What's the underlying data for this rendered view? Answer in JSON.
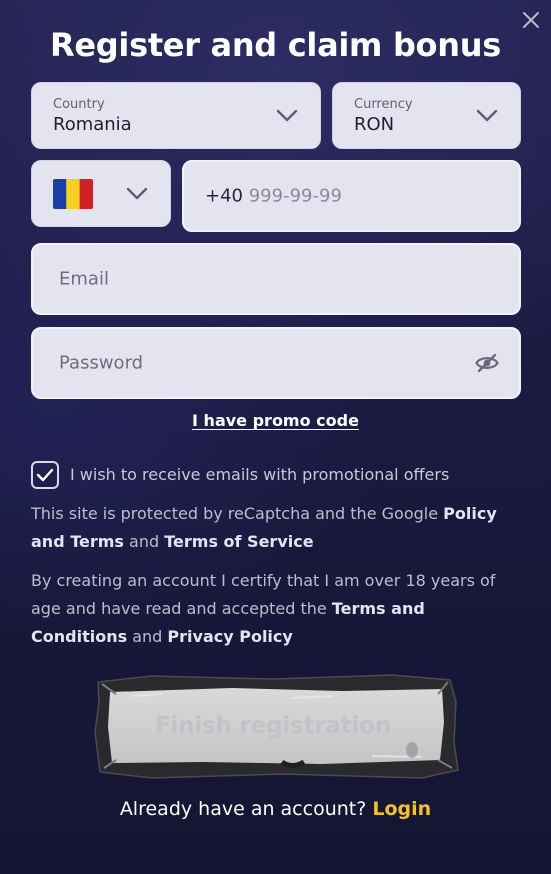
{
  "header": {
    "title": "Register and claim bonus"
  },
  "country": {
    "label": "Country",
    "value": "Romania"
  },
  "currency": {
    "label": "Currency",
    "value": "RON"
  },
  "phone": {
    "flag": "romania-flag-icon",
    "prefix": "+40",
    "mask": "999-99-99"
  },
  "email": {
    "placeholder": "Email"
  },
  "password": {
    "placeholder": "Password",
    "visibility_icon": "eye-slash-icon"
  },
  "promo": {
    "label": "I have promo code"
  },
  "consent": {
    "checked": true,
    "label": "I wish to receive emails with promotional offers"
  },
  "recaptcha": {
    "text_1": "This site is protected by reCaptcha and the Google",
    "policy_link": "Policy and Terms",
    "text_2": "and",
    "terms_link": "Terms of Service"
  },
  "certify": {
    "text_1": "By creating an account I certify that I am over 18 years of age and have read and accepted the",
    "terms_link": "Terms and Conditions",
    "text_2": "and",
    "privacy_link": "Privacy Policy"
  },
  "submit": {
    "label": "Finish registration"
  },
  "footer": {
    "prompt": "Already have an account?",
    "login_link": "Login"
  },
  "colors": {
    "background": "#1b1a40",
    "field": "#e4e4f1",
    "accent": "#f6c223",
    "flag_blue": "#1a3fa8",
    "flag_yellow": "#f7d021",
    "flag_red": "#d31f28"
  }
}
